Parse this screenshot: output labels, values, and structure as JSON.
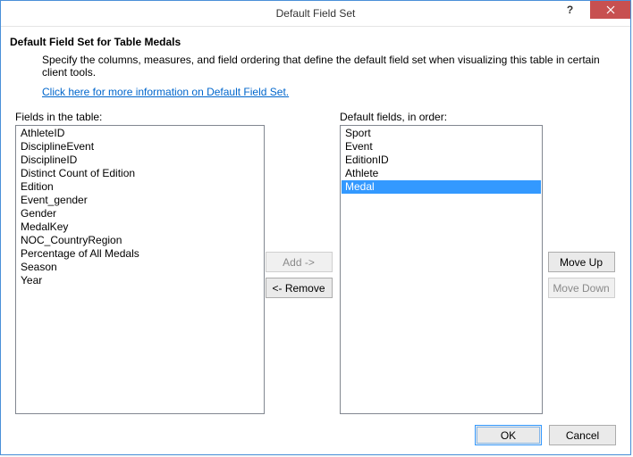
{
  "window": {
    "title": "Default Field Set"
  },
  "header": {
    "heading": "Default Field Set for Table Medals",
    "description": "Specify the columns, measures, and field ordering that define the default field set when visualizing this table in certain client tools.",
    "link_text": "Click here for more information on Default Field Set."
  },
  "labels": {
    "left_list": "Fields in the table:",
    "right_list": "Default fields, in order:"
  },
  "buttons": {
    "add": "Add ->",
    "remove": "<- Remove",
    "move_up": "Move Up",
    "move_down": "Move Down",
    "ok": "OK",
    "cancel": "Cancel"
  },
  "table_fields": [
    "AthleteID",
    "DisciplineEvent",
    "DisciplineID",
    "Distinct Count of Edition",
    "Edition",
    "Event_gender",
    "Gender",
    "MedalKey",
    "NOC_CountryRegion",
    "Percentage of All Medals",
    "Season",
    "Year"
  ],
  "default_fields": [
    {
      "name": "Sport",
      "selected": false
    },
    {
      "name": "Event",
      "selected": false
    },
    {
      "name": "EditionID",
      "selected": false
    },
    {
      "name": "Athlete",
      "selected": false
    },
    {
      "name": "Medal",
      "selected": true
    }
  ],
  "state": {
    "add_enabled": false,
    "remove_enabled": true,
    "move_up_enabled": true,
    "move_down_enabled": false
  }
}
